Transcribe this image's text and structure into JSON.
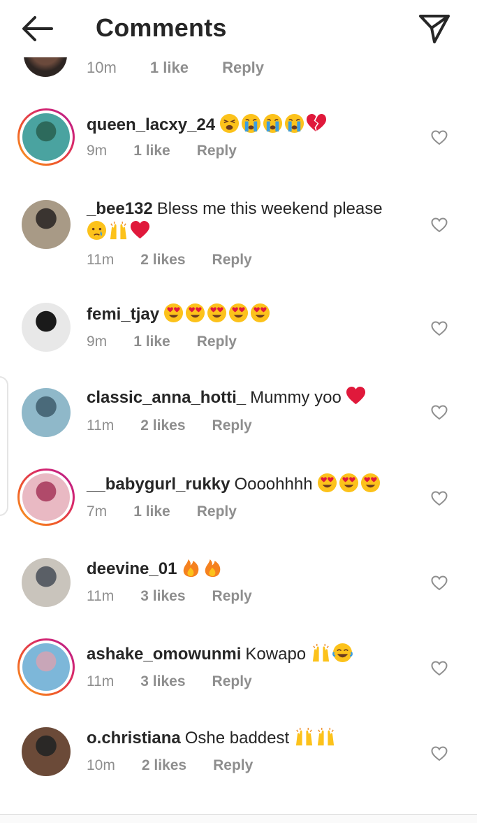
{
  "header": {
    "title": "Comments",
    "back_icon": "arrow-left-icon",
    "send_icon": "paper-plane-icon"
  },
  "partial_top": {
    "time": "10m",
    "likes": "1 like",
    "reply": "Reply"
  },
  "comments": [
    {
      "username": "queen_lacxy_24",
      "text": "",
      "emojis": [
        "weary",
        "crying",
        "crying",
        "crying",
        "broken-heart"
      ],
      "time": "9m",
      "likes": "1 like",
      "reply": "Reply",
      "ring": true
    },
    {
      "username": "_bee132",
      "text": "Bless me this weekend please",
      "emojis": [
        "tear",
        "raising-hands",
        "red-heart"
      ],
      "time": "11m",
      "likes": "2 likes",
      "reply": "Reply",
      "ring": false
    },
    {
      "username": "femi_tjay",
      "text": "",
      "emojis": [
        "heart-eyes",
        "heart-eyes",
        "heart-eyes",
        "heart-eyes",
        "heart-eyes"
      ],
      "time": "9m",
      "likes": "1 like",
      "reply": "Reply",
      "ring": false
    },
    {
      "username": "classic_anna_hotti_",
      "text": "Mummy yoo",
      "emojis": [
        "red-heart"
      ],
      "time": "11m",
      "likes": "2 likes",
      "reply": "Reply",
      "ring": false
    },
    {
      "username": "__babygurl_rukky",
      "text": "Oooohhhh",
      "emojis": [
        "heart-eyes",
        "heart-eyes",
        "heart-eyes"
      ],
      "time": "7m",
      "likes": "1 like",
      "reply": "Reply",
      "ring": true
    },
    {
      "username": "deevine_01",
      "text": "",
      "emojis": [
        "fire",
        "fire"
      ],
      "time": "11m",
      "likes": "3 likes",
      "reply": "Reply",
      "ring": false
    },
    {
      "username": "ashake_omowunmi",
      "text": "Kowapo",
      "emojis": [
        "raising-hands",
        "joy"
      ],
      "time": "11m",
      "likes": "3 likes",
      "reply": "Reply",
      "ring": true
    },
    {
      "username": "o.christiana",
      "text": "Oshe baddest",
      "emojis": [
        "raising-hands",
        "raising-hands"
      ],
      "time": "10m",
      "likes": "2 likes",
      "reply": "Reply",
      "ring": false
    }
  ],
  "colors": {
    "text": "#262626",
    "meta": "#8e8e8e",
    "ring_start": "#f9a825",
    "ring_end": "#b0208f"
  }
}
